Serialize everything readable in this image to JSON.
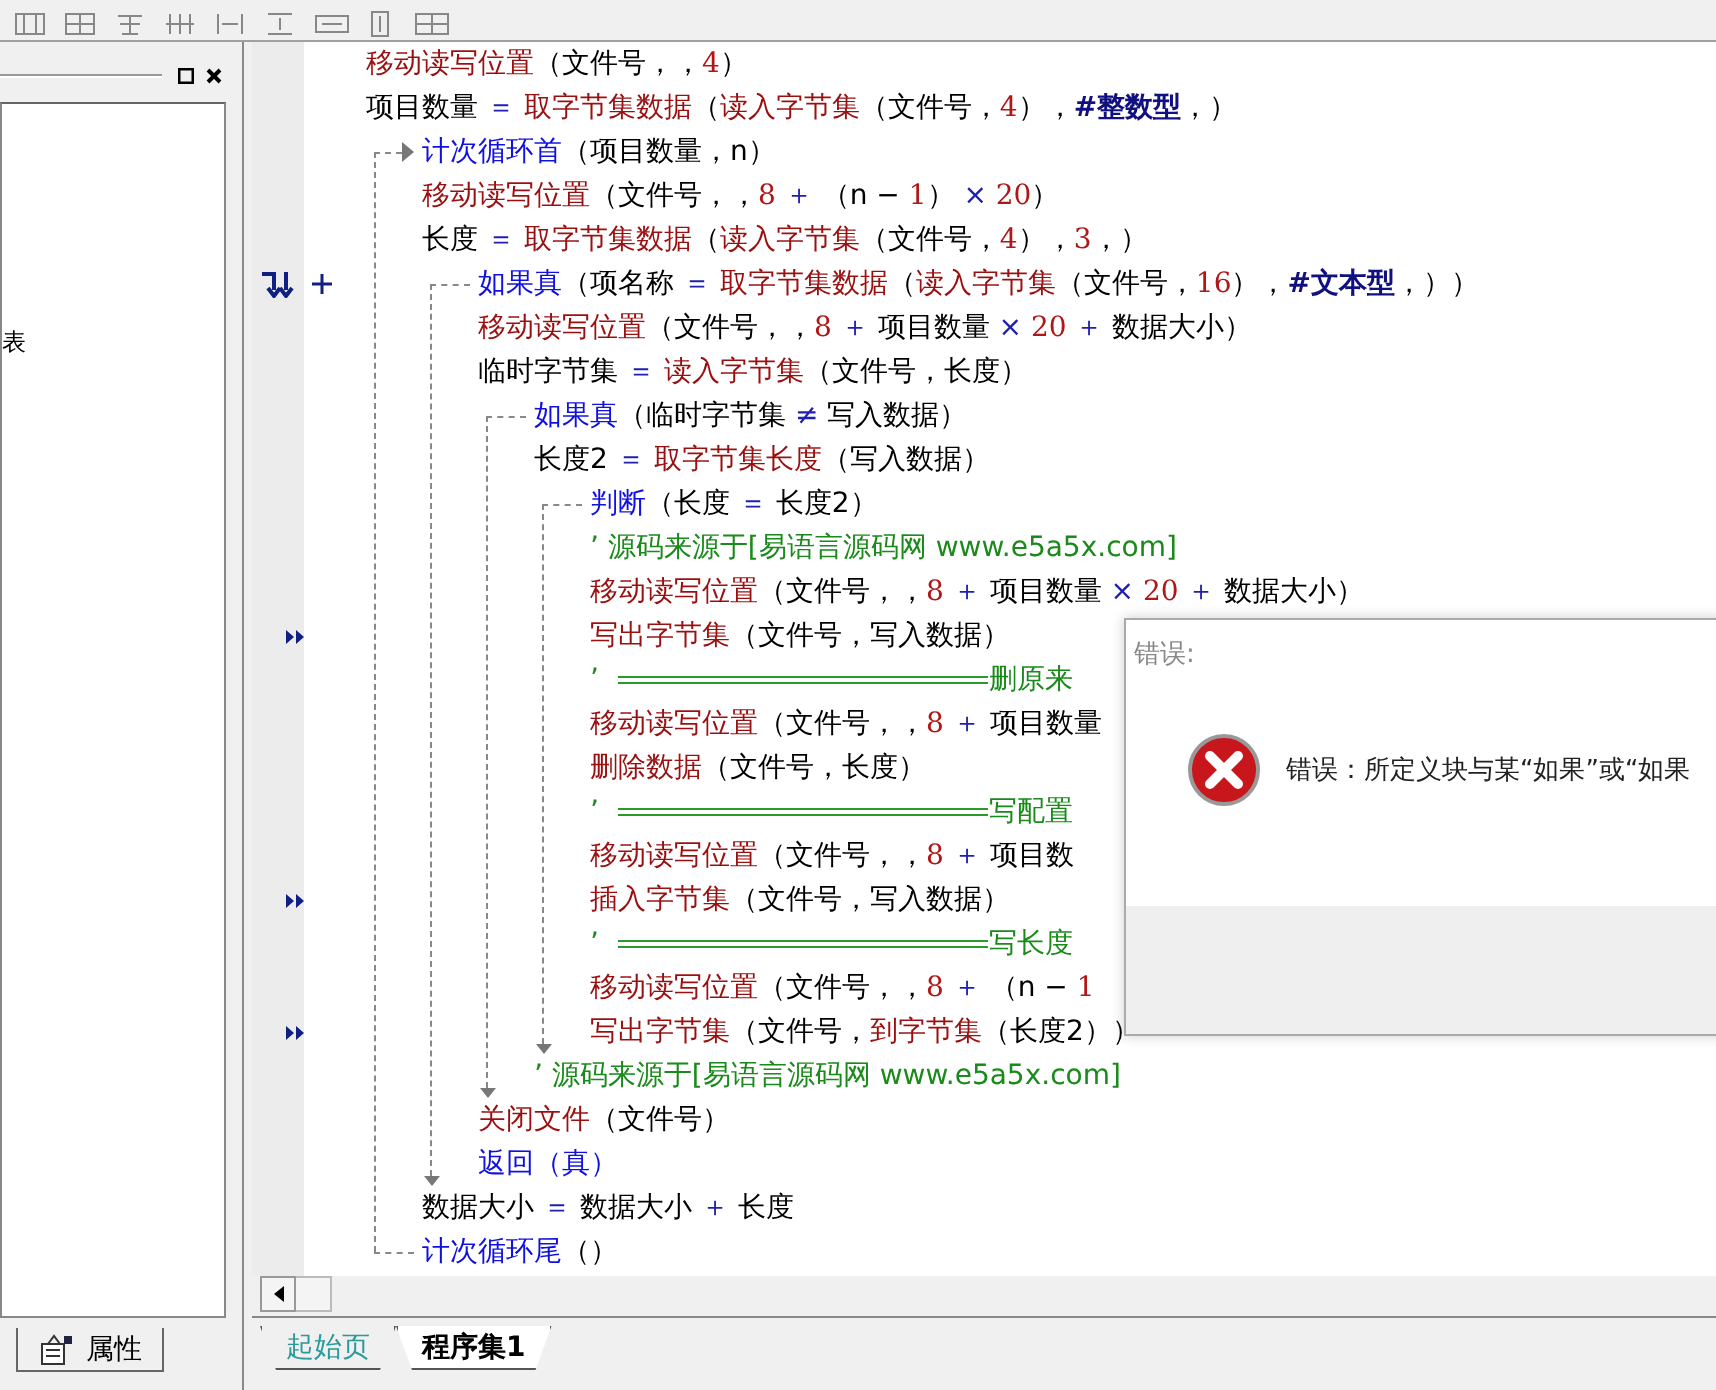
{
  "side_panel": {
    "list_text": "表",
    "tab_label": "属性"
  },
  "code": [
    {
      "kind": "code",
      "tokens": [
        {
          "kind": "cmd",
          "text": "移动读写位置"
        },
        {
          "kind": "text",
          "text": "（文件号，，"
        },
        {
          "kind": "num",
          "text": "4"
        },
        {
          "kind": "text",
          "text": "）"
        }
      ]
    },
    {
      "kind": "code",
      "tokens": [
        {
          "kind": "text",
          "text": "项目数量 "
        },
        {
          "kind": "op",
          "text": "＝ "
        },
        {
          "kind": "cmd",
          "text": "取字节集数据"
        },
        {
          "kind": "text",
          "text": "（"
        },
        {
          "kind": "cmd",
          "text": "读入字节集"
        },
        {
          "kind": "text",
          "text": "（文件号，"
        },
        {
          "kind": "num",
          "text": "4"
        },
        {
          "kind": "text",
          "text": "），"
        },
        {
          "kind": "const",
          "text": "#整数型"
        },
        {
          "kind": "text",
          "text": "，）"
        }
      ]
    },
    {
      "kind": "loop",
      "header": [
        {
          "kind": "kw",
          "text": "计次循环首"
        },
        {
          "kind": "text",
          "text": "（项目数量，n）"
        }
      ],
      "footer": [
        {
          "kind": "kw",
          "text": "计次循环尾"
        },
        {
          "kind": "text",
          "text": "（）"
        }
      ],
      "children": [
        {
          "kind": "code",
          "tokens": [
            {
              "kind": "cmd",
              "text": "移动读写位置"
            },
            {
              "kind": "text",
              "text": "（文件号，，"
            },
            {
              "kind": "num",
              "text": "8 "
            },
            {
              "kind": "op",
              "text": "＋ "
            },
            {
              "kind": "text",
              "text": "（n − "
            },
            {
              "kind": "num",
              "text": "1"
            },
            {
              "kind": "text",
              "text": "） "
            },
            {
              "kind": "op",
              "text": "× "
            },
            {
              "kind": "num",
              "text": "20"
            },
            {
              "kind": "text",
              "text": "）"
            }
          ]
        },
        {
          "kind": "code",
          "tokens": [
            {
              "kind": "text",
              "text": "长度 "
            },
            {
              "kind": "op",
              "text": "＝ "
            },
            {
              "kind": "cmd",
              "text": "取字节集数据"
            },
            {
              "kind": "text",
              "text": "（"
            },
            {
              "kind": "cmd",
              "text": "读入字节集"
            },
            {
              "kind": "text",
              "text": "（文件号，"
            },
            {
              "kind": "num",
              "text": "4"
            },
            {
              "kind": "text",
              "text": "），"
            },
            {
              "kind": "num",
              "text": "3"
            },
            {
              "kind": "text",
              "text": "，）"
            }
          ]
        },
        {
          "kind": "if",
          "gutter": {
            "kind": "fold"
          },
          "header": [
            {
              "kind": "kw",
              "text": "如果真"
            },
            {
              "kind": "text",
              "text": "（项名称 "
            },
            {
              "kind": "op",
              "text": "＝ "
            },
            {
              "kind": "cmd",
              "text": "取字节集数据"
            },
            {
              "kind": "text",
              "text": "（"
            },
            {
              "kind": "cmd",
              "text": "读入字节集"
            },
            {
              "kind": "text",
              "text": "（文件号，"
            },
            {
              "kind": "num",
              "text": "16"
            },
            {
              "kind": "text",
              "text": "），"
            },
            {
              "kind": "const",
              "text": "#文本型"
            },
            {
              "kind": "text",
              "text": "，））"
            }
          ],
          "children": [
            {
              "kind": "code",
              "tokens": [
                {
                  "kind": "cmd",
                  "text": "移动读写位置"
                },
                {
                  "kind": "text",
                  "text": "（文件号，，"
                },
                {
                  "kind": "num",
                  "text": "8 "
                },
                {
                  "kind": "op",
                  "text": "＋ "
                },
                {
                  "kind": "text",
                  "text": "项目数量 "
                },
                {
                  "kind": "op",
                  "text": "× "
                },
                {
                  "kind": "num",
                  "text": "20 "
                },
                {
                  "kind": "op",
                  "text": "＋ "
                },
                {
                  "kind": "text",
                  "text": "数据大小）"
                }
              ]
            },
            {
              "kind": "code",
              "tokens": [
                {
                  "kind": "text",
                  "text": "临时字节集 "
                },
                {
                  "kind": "op",
                  "text": "＝ "
                },
                {
                  "kind": "cmd",
                  "text": "读入字节集"
                },
                {
                  "kind": "text",
                  "text": "（文件号，长度）"
                }
              ]
            },
            {
              "kind": "if",
              "header": [
                {
                  "kind": "kw",
                  "text": "如果真"
                },
                {
                  "kind": "text",
                  "text": "（临时字节集 "
                },
                {
                  "kind": "op",
                  "text": "≠ "
                },
                {
                  "kind": "text",
                  "text": "写入数据）"
                }
              ],
              "children": [
                {
                  "kind": "code",
                  "tokens": [
                    {
                      "kind": "text",
                      "text": "长度2 "
                    },
                    {
                      "kind": "op",
                      "text": "＝ "
                    },
                    {
                      "kind": "cmd",
                      "text": "取字节集长度"
                    },
                    {
                      "kind": "text",
                      "text": "（写入数据）"
                    }
                  ]
                },
                {
                  "kind": "if",
                  "header": [
                    {
                      "kind": "kw",
                      "text": "判断"
                    },
                    {
                      "kind": "text",
                      "text": "（长度 "
                    },
                    {
                      "kind": "op",
                      "text": "＝ "
                    },
                    {
                      "kind": "text",
                      "text": "长度2）"
                    }
                  ],
                  "children": [
                    {
                      "kind": "comment",
                      "text": "’ 源码来源于[易语言源码网 www.e5a5x.com]"
                    },
                    {
                      "kind": "code",
                      "tokens": [
                        {
                          "kind": "cmd",
                          "text": "移动读写位置"
                        },
                        {
                          "kind": "text",
                          "text": "（文件号，，"
                        },
                        {
                          "kind": "num",
                          "text": "8 "
                        },
                        {
                          "kind": "op",
                          "text": "＋ "
                        },
                        {
                          "kind": "text",
                          "text": "项目数量 "
                        },
                        {
                          "kind": "op",
                          "text": "× "
                        },
                        {
                          "kind": "num",
                          "text": "20 "
                        },
                        {
                          "kind": "op",
                          "text": "＋ "
                        },
                        {
                          "kind": "text",
                          "text": "数据大小）"
                        }
                      ]
                    },
                    {
                      "kind": "code",
                      "gutter": {
                        "kind": "breakpoint"
                      },
                      "tokens": [
                        {
                          "kind": "cmd",
                          "text": "写出字节集"
                        },
                        {
                          "kind": "text",
                          "text": "（文件号，写入数据）"
                        }
                      ]
                    },
                    {
                      "kind": "banner",
                      "quote": "’",
                      "text": "删原来"
                    },
                    {
                      "kind": "code",
                      "tokens": [
                        {
                          "kind": "cmd",
                          "text": "移动读写位置"
                        },
                        {
                          "kind": "text",
                          "text": "（文件号，，"
                        },
                        {
                          "kind": "num",
                          "text": "8 "
                        },
                        {
                          "kind": "op",
                          "text": "＋ "
                        },
                        {
                          "kind": "text",
                          "text": "项目数量"
                        }
                      ]
                    },
                    {
                      "kind": "code",
                      "tokens": [
                        {
                          "kind": "cmd",
                          "text": "删除数据"
                        },
                        {
                          "kind": "text",
                          "text": "（文件号，长度）"
                        }
                      ]
                    },
                    {
                      "kind": "banner",
                      "quote": "’",
                      "text": "写配置"
                    },
                    {
                      "kind": "code",
                      "tokens": [
                        {
                          "kind": "cmd",
                          "text": "移动读写位置"
                        },
                        {
                          "kind": "text",
                          "text": "（文件号，，"
                        },
                        {
                          "kind": "num",
                          "text": "8 "
                        },
                        {
                          "kind": "op",
                          "text": "＋ "
                        },
                        {
                          "kind": "text",
                          "text": "项目数"
                        }
                      ]
                    },
                    {
                      "kind": "code",
                      "gutter": {
                        "kind": "breakpoint"
                      },
                      "tokens": [
                        {
                          "kind": "cmd",
                          "text": "插入字节集"
                        },
                        {
                          "kind": "text",
                          "text": "（文件号，写入数据）"
                        }
                      ]
                    },
                    {
                      "kind": "banner",
                      "quote": "’",
                      "text": "写长度"
                    },
                    {
                      "kind": "code",
                      "tokens": [
                        {
                          "kind": "cmd",
                          "text": "移动读写位置"
                        },
                        {
                          "kind": "text",
                          "text": "（文件号，，"
                        },
                        {
                          "kind": "num",
                          "text": "8 "
                        },
                        {
                          "kind": "op",
                          "text": "＋ "
                        },
                        {
                          "kind": "text",
                          "text": "（n − "
                        },
                        {
                          "kind": "num",
                          "text": "1"
                        }
                      ]
                    },
                    {
                      "kind": "code",
                      "gutter": {
                        "kind": "breakpoint"
                      },
                      "tokens": [
                        {
                          "kind": "cmd",
                          "text": "写出字节集"
                        },
                        {
                          "kind": "text",
                          "text": "（文件号，"
                        },
                        {
                          "kind": "cmd",
                          "text": "到字节集"
                        },
                        {
                          "kind": "text",
                          "text": "（长度2））"
                        }
                      ]
                    }
                  ]
                },
                {
                  "kind": "comment",
                  "text": "’ 源码来源于[易语言源码网 www.e5a5x.com]"
                }
              ]
            },
            {
              "kind": "code",
              "tokens": [
                {
                  "kind": "cmd",
                  "text": "关闭文件"
                },
                {
                  "kind": "text",
                  "text": "（文件号）"
                }
              ]
            },
            {
              "kind": "code",
              "tokens": [
                {
                  "kind": "kw",
                  "text": "返回"
                },
                {
                  "kind": "kw",
                  "text": "（真）"
                }
              ]
            }
          ]
        },
        {
          "kind": "code",
          "tokens": [
            {
              "kind": "text",
              "text": "数据大小 "
            },
            {
              "kind": "op",
              "text": "＝ "
            },
            {
              "kind": "text",
              "text": "数据大小 "
            },
            {
              "kind": "op",
              "text": "＋ "
            },
            {
              "kind": "text",
              "text": "长度"
            }
          ]
        }
      ]
    }
  ],
  "dialog": {
    "title": "错误:",
    "message": "错误：所定义块与某“如果”或“如果"
  },
  "tabs": [
    {
      "label": "起始页",
      "selected": false
    },
    {
      "label": "程序集1",
      "selected": true
    }
  ]
}
